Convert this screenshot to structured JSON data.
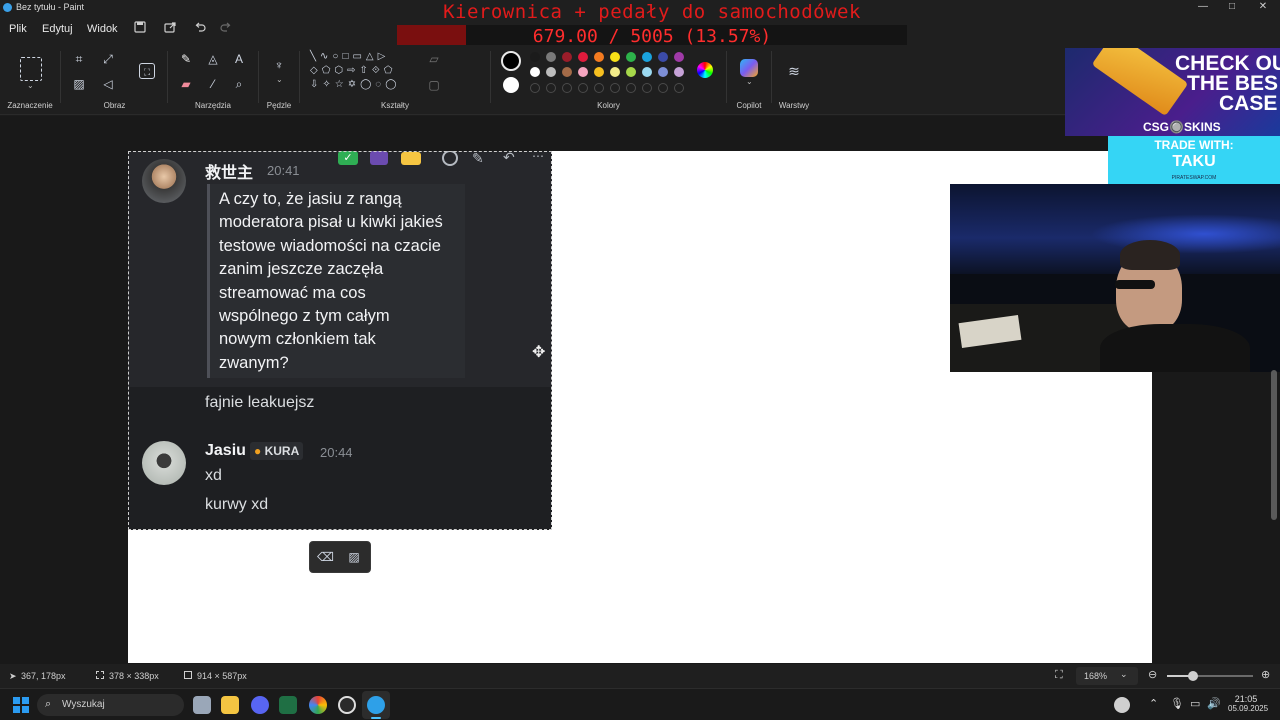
{
  "window": {
    "title": "Bez tytułu - Paint",
    "controls": {
      "minimize": "—",
      "maximize": "□",
      "close": "✕"
    }
  },
  "menu": {
    "items": [
      "Plik",
      "Edytuj",
      "Widok"
    ],
    "quick_icons": [
      "save-icon",
      "share-icon",
      "undo-icon",
      "redo-icon"
    ]
  },
  "donation": {
    "title": "Kierownica + pedały do samochodówek",
    "progress_text": "679.00 / 5005 (13.57%)",
    "progress_fraction": 0.1357,
    "color": "#e21b1b"
  },
  "ribbon": {
    "groups": {
      "selection": "Zaznaczenie",
      "image": "Obraz",
      "tools": "Narzędzia",
      "brushes": "Pędzle",
      "shapes": "Kształty",
      "colors": "Kolory",
      "copilot": "Copilot",
      "layers": "Warstwy"
    },
    "palette_row1": [
      "#1b1b1b",
      "#7a7a7a",
      "#9b1d2a",
      "#e01b3c",
      "#f47b20",
      "#f7e017",
      "#2db34a",
      "#1aa3de",
      "#3b4ba8",
      "#a03aa8"
    ],
    "palette_row2": [
      "#ffffff",
      "#bdbdbd",
      "#a46b48",
      "#f6a5c0",
      "#f7c020",
      "#f2ec8a",
      "#a6d84a",
      "#9bd9f0",
      "#7d8fd6",
      "#c6a2d8"
    ],
    "primary_color": "#000000",
    "secondary_color": "#ffffff"
  },
  "chat": {
    "msg1": {
      "user": "救世主",
      "time": "20:41",
      "quote_lines": [
        "A czy to, że jasiu z rangą",
        "moderatora pisał u kiwki jakieś",
        "testowe wiadomości na czacie",
        "zanim jeszcze zaczęła",
        "streamować ma cos",
        "wspólnego z tym całym",
        "nowym członkiem tak",
        "zwanym?"
      ],
      "reply": "fajnie leakuejsz"
    },
    "msg2": {
      "user": "Jasiu",
      "badge": "KURA",
      "time": "20:44",
      "lines": [
        "xd",
        "kurwy xd"
      ]
    }
  },
  "promo": {
    "headline1": "CHECK OU",
    "headline2": "THE BES",
    "headline3": "CASE",
    "brand": "CSG🔘SKINS",
    "trade": "TRADE WITH:",
    "name": "TAKU",
    "small": "PIRATESWAP.COM"
  },
  "statusbar": {
    "cursor": "367, 178px",
    "selection": "378 × 338px",
    "canvas": "914 × 587px",
    "zoom": "168%",
    "zoom_level": 0.3
  },
  "taskbar": {
    "search_placeholder": "Wyszukaj",
    "time": "21:05",
    "date": "05.09.2025"
  }
}
